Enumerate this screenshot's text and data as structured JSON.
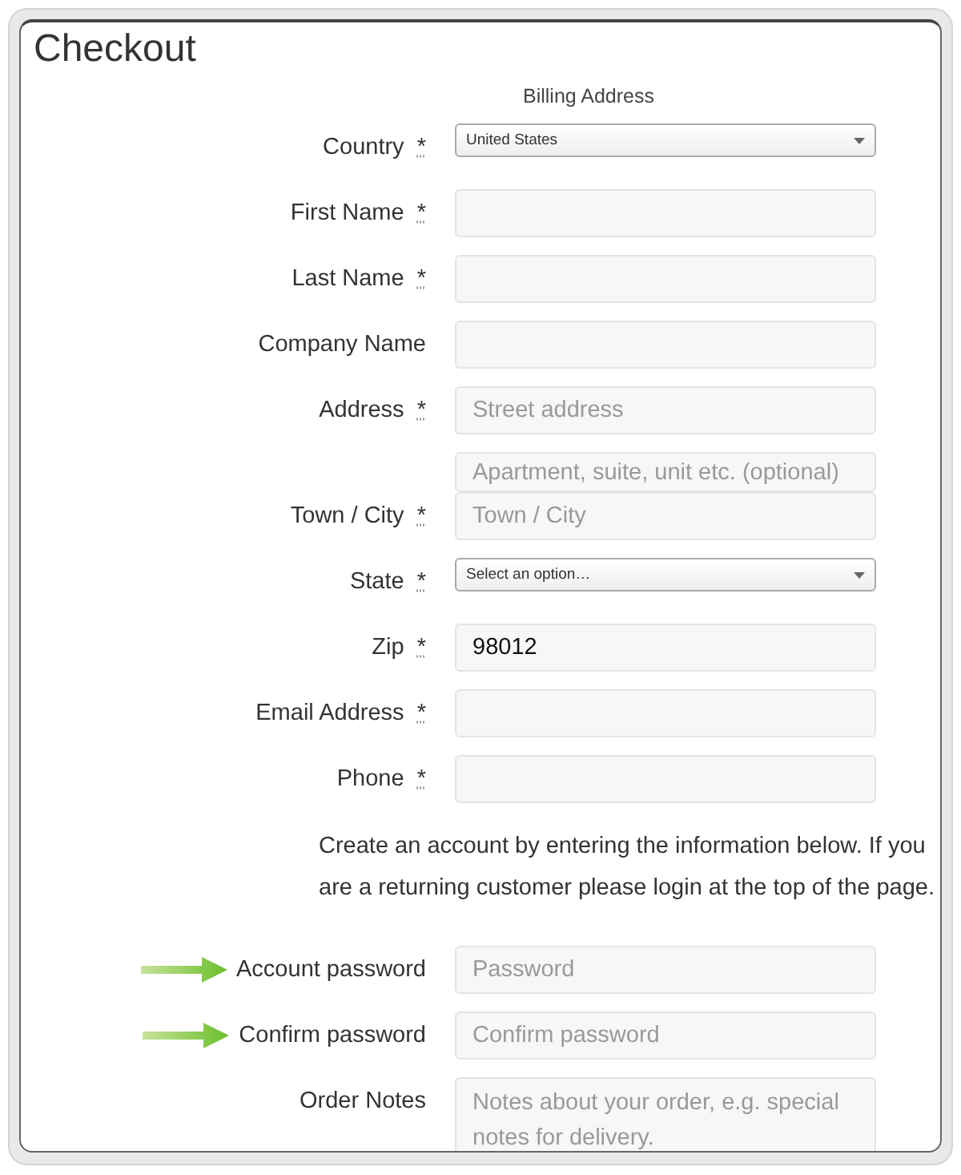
{
  "title": "Checkout",
  "section_heading": "Billing Address",
  "fields": [
    {
      "label": "Country",
      "required_mark": "*",
      "kind": "select",
      "value": "United States",
      "highlighted": false
    },
    {
      "label": "First Name",
      "required_mark": "*",
      "kind": "text",
      "highlighted": false
    },
    {
      "label": "Last Name",
      "required_mark": "*",
      "kind": "text",
      "highlighted": false
    },
    {
      "label": "Company Name",
      "kind": "text",
      "highlighted": false
    },
    {
      "label": "Address",
      "required_mark": "*",
      "kind": "text",
      "inputs": [
        {
          "placeholder": "Street address"
        },
        {
          "placeholder": "Apartment, suite, unit etc. (optional)"
        }
      ],
      "highlighted": false
    },
    {
      "label": "Town / City",
      "required_mark": "*",
      "kind": "text",
      "inputs": [
        {
          "placeholder": "Town / City"
        }
      ],
      "highlighted": false
    },
    {
      "label": "State",
      "required_mark": "*",
      "kind": "select",
      "value": "Select an option…",
      "highlighted": false
    },
    {
      "label": "Zip",
      "required_mark": "*",
      "kind": "text",
      "inputs": [
        {
          "value": "98012"
        }
      ],
      "highlighted": false
    },
    {
      "label": "Email Address",
      "required_mark": "*",
      "kind": "text",
      "highlighted": false
    },
    {
      "label": "Phone",
      "required_mark": "*",
      "kind": "text",
      "highlighted": false
    }
  ],
  "account_note": "Create an account by entering the information below. If you are a returning customer please login at the top of the page.",
  "account_fields": [
    {
      "label": "Account password",
      "kind": "text",
      "inputs": [
        {
          "placeholder": "Password"
        }
      ],
      "highlighted": true
    },
    {
      "label": "Confirm password",
      "kind": "text",
      "inputs": [
        {
          "placeholder": "Confirm password"
        }
      ],
      "highlighted": true
    },
    {
      "label": "Order Notes",
      "kind": "textarea",
      "inputs": [
        {
          "placeholder": "Notes about your order, e.g. special notes for delivery."
        }
      ],
      "highlighted": false
    }
  ]
}
